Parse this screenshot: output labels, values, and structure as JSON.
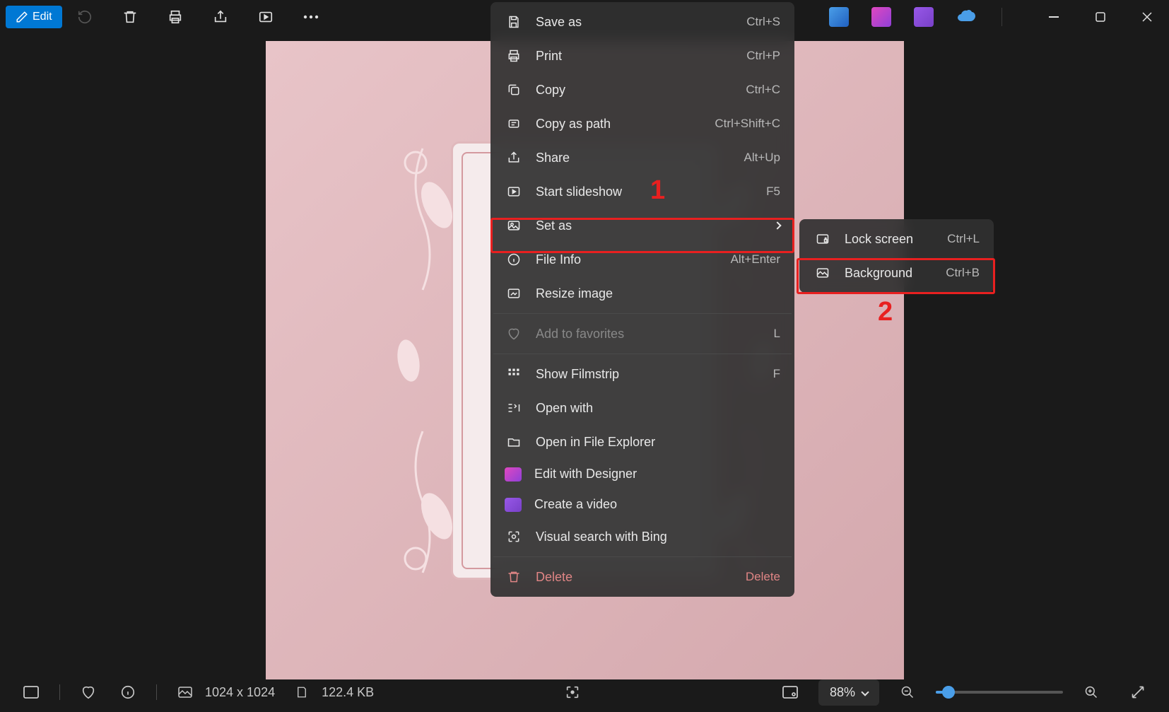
{
  "titlebar": {
    "edit_label": "Edit"
  },
  "context_menu": {
    "items": [
      {
        "icon": "save-icon",
        "label": "Save as",
        "shortcut": "Ctrl+S"
      },
      {
        "icon": "print-icon",
        "label": "Print",
        "shortcut": "Ctrl+P"
      },
      {
        "icon": "copy-icon",
        "label": "Copy",
        "shortcut": "Ctrl+C"
      },
      {
        "icon": "copy-path-icon",
        "label": "Copy as path",
        "shortcut": "Ctrl+Shift+C"
      },
      {
        "icon": "share-icon",
        "label": "Share",
        "shortcut": "Alt+Up"
      },
      {
        "icon": "slideshow-icon",
        "label": "Start slideshow",
        "shortcut": "F5"
      },
      {
        "icon": "set-as-icon",
        "label": "Set as",
        "submenu": true
      },
      {
        "icon": "info-icon",
        "label": "File Info",
        "shortcut": "Alt+Enter"
      },
      {
        "icon": "resize-icon",
        "label": "Resize image",
        "shortcut": ""
      }
    ],
    "items2": [
      {
        "icon": "heart-icon",
        "label": "Add to favorites",
        "shortcut": "L",
        "disabled": true
      }
    ],
    "items3": [
      {
        "icon": "filmstrip-icon",
        "label": "Show Filmstrip",
        "shortcut": "F"
      },
      {
        "icon": "open-with-icon",
        "label": "Open with",
        "shortcut": ""
      },
      {
        "icon": "folder-icon",
        "label": "Open in File Explorer",
        "shortcut": ""
      },
      {
        "icon": "designer-icon",
        "label": "Edit with Designer",
        "shortcut": "",
        "colored": "#d04eb8"
      },
      {
        "icon": "video-icon",
        "label": "Create a video",
        "shortcut": "",
        "colored": "#8252d8"
      },
      {
        "icon": "search-icon",
        "label": "Visual search with Bing",
        "shortcut": ""
      }
    ],
    "delete": {
      "label": "Delete",
      "shortcut": "Delete"
    }
  },
  "submenu": {
    "lock_screen": "Lock screen",
    "lock_shortcut": "Ctrl+L",
    "background": "Background",
    "bg_shortcut": "Ctrl+B"
  },
  "annotations": {
    "num1": "1",
    "num2": "2"
  },
  "statusbar": {
    "dimensions": "1024 x 1024",
    "filesize": "122.4 KB",
    "zoom": "88%"
  }
}
